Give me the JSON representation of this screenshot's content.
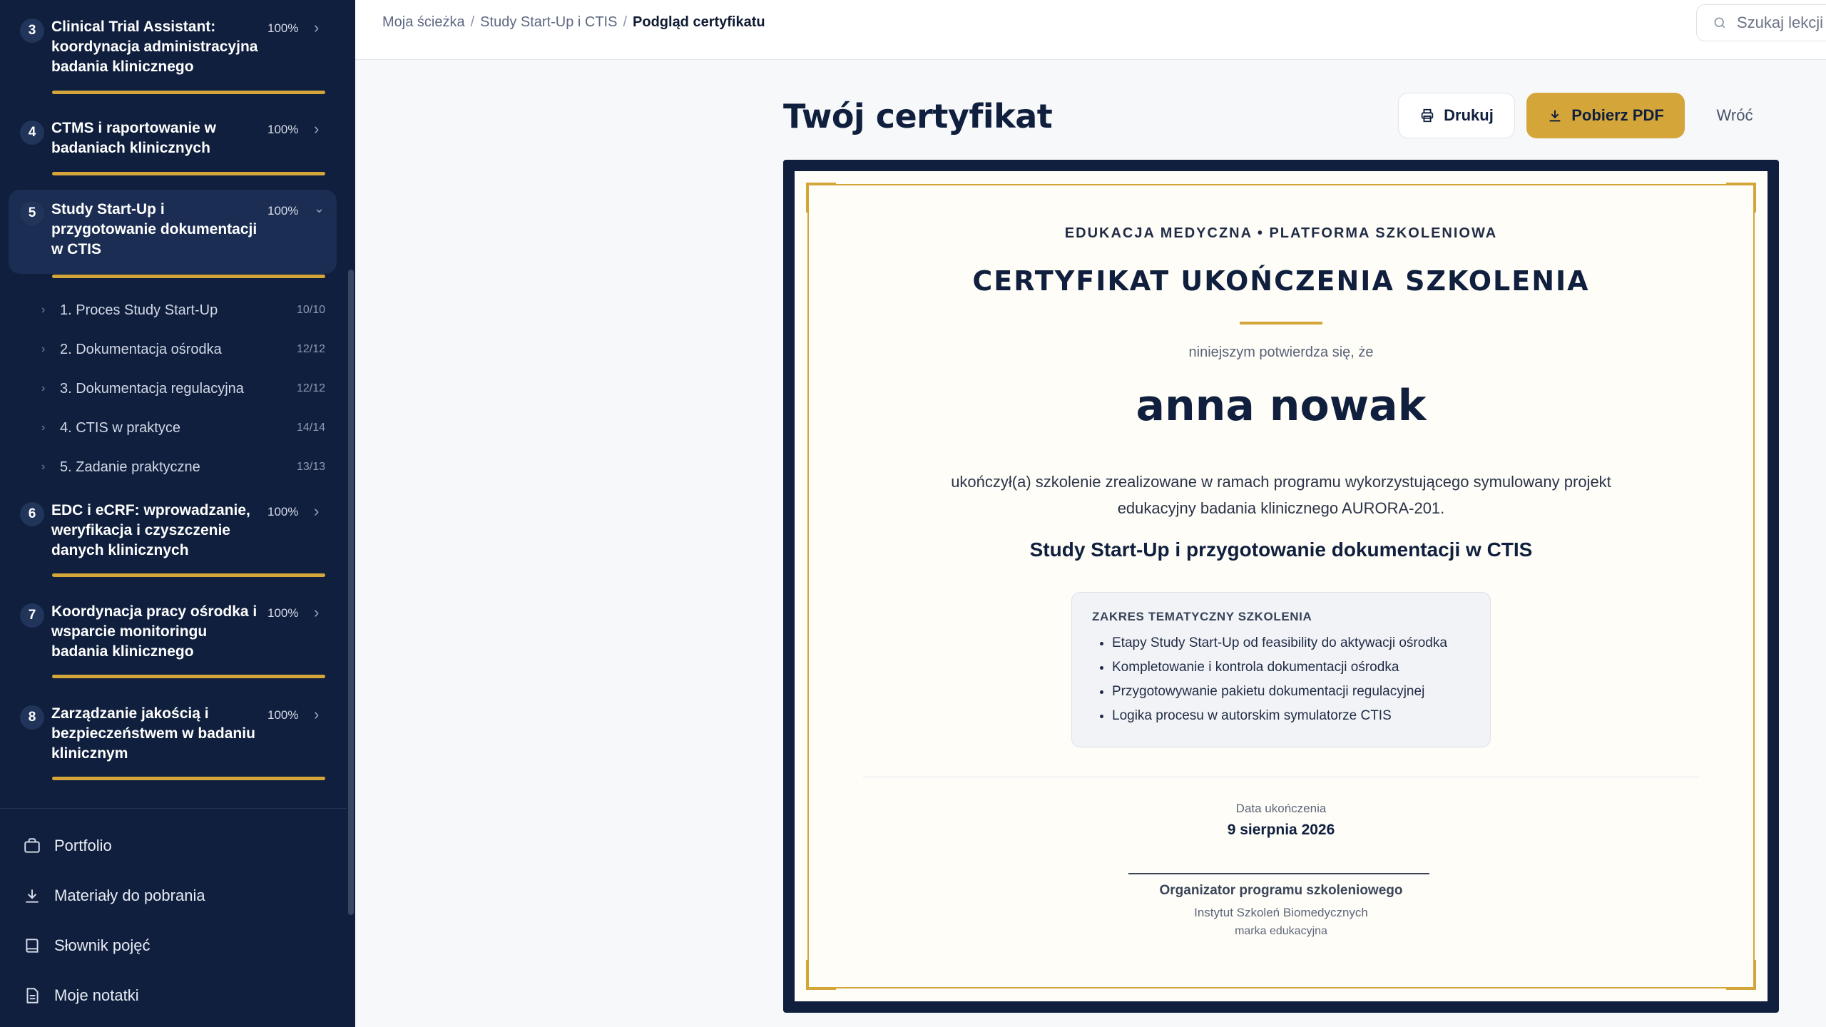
{
  "sidebar": {
    "modules": [
      {
        "num": "3",
        "title": "Clinical Trial Assistant: koordynacja administracyjna badania klinicznego",
        "progress": "100%",
        "progress_value": 100,
        "expanded": false
      },
      {
        "num": "4",
        "title": "CTMS i raportowanie w badaniach klinicznych",
        "progress": "100%",
        "progress_value": 100,
        "expanded": false
      },
      {
        "num": "5",
        "title": "Study Start-Up i przygotowanie dokumentacji w CTIS",
        "progress": "100%",
        "progress_value": 100,
        "expanded": true
      },
      {
        "num": "6",
        "title": "EDC i eCRF: wprowadzanie, weryfikacja i czyszczenie danych klinicznych",
        "progress": "100%",
        "progress_value": 100,
        "expanded": false
      },
      {
        "num": "7",
        "title": "Koordynacja pracy ośrodka i wsparcie monitoringu badania klinicznego",
        "progress": "100%",
        "progress_value": 100,
        "expanded": false
      },
      {
        "num": "8",
        "title": "Zarządzanie jakością i bezpieczeństwem w badaniu klinicznym",
        "progress": "100%",
        "progress_value": 100,
        "expanded": false
      }
    ],
    "lessons": [
      {
        "label": "1. Proces Study Start-Up",
        "count": "10/10"
      },
      {
        "label": "2. Dokumentacja ośrodka",
        "count": "12/12"
      },
      {
        "label": "3. Dokumentacja regulacyjna",
        "count": "12/12"
      },
      {
        "label": "4. CTIS w praktyce",
        "count": "14/14"
      },
      {
        "label": "5. Zadanie praktyczne",
        "count": "13/13"
      }
    ],
    "links": [
      {
        "label": "Portfolio",
        "icon": "briefcase-icon"
      },
      {
        "label": "Materiały do pobrania",
        "icon": "download-icon"
      },
      {
        "label": "Słownik pojęć",
        "icon": "book-icon"
      },
      {
        "label": "Moje notatki",
        "icon": "notes-icon"
      }
    ]
  },
  "topbar": {
    "breadcrumb": [
      "Moja ścieżka",
      "Study Start-Up i CTIS",
      "Podgląd certyfikatu"
    ],
    "search_placeholder": "Szukaj lekcji"
  },
  "header": {
    "title": "Twój certyfikat",
    "print_label": "Drukuj",
    "pdf_label": "Pobierz PDF",
    "back_label": "Wróć"
  },
  "certificate": {
    "organization": "EDUKACJA MEDYCZNA • PLATFORMA SZKOLENIOWA",
    "title": "CERTYFIKAT UKOŃCZENIA SZKOLENIA",
    "intro": "niniejszym potwierdza się, że",
    "name": "anna nowak",
    "description": "ukończył(a) szkolenie zrealizowane w ramach programu wykorzystującego symulowany projekt edukacyjny badania klinicznego AURORA-201.",
    "course": "Study Start-Up i przygotowanie dokumentacji w CTIS",
    "scope_title": "ZAKRES TEMATYCZNY SZKOLENIA",
    "scope_items": [
      "Etapy Study Start-Up od feasibility do aktywacji ośrodka",
      "Kompletowanie i kontrola dokumentacji ośrodka",
      "Przygotowywanie pakietu dokumentacji regulacyjnej",
      "Logika procesu w autorskim symulatorze CTIS"
    ],
    "date_label": "Data ukończenia",
    "date": "9 sierpnia 2026",
    "signature_title": "Organizator programu szkoleniowego",
    "signature_institution": "Instytut Szkoleń Biomedycznych",
    "signature_sub": "marka edukacyjna"
  },
  "colors": {
    "navy": "#0f1f3d",
    "gold": "#d4a63a",
    "paper": "#fffdf8"
  }
}
